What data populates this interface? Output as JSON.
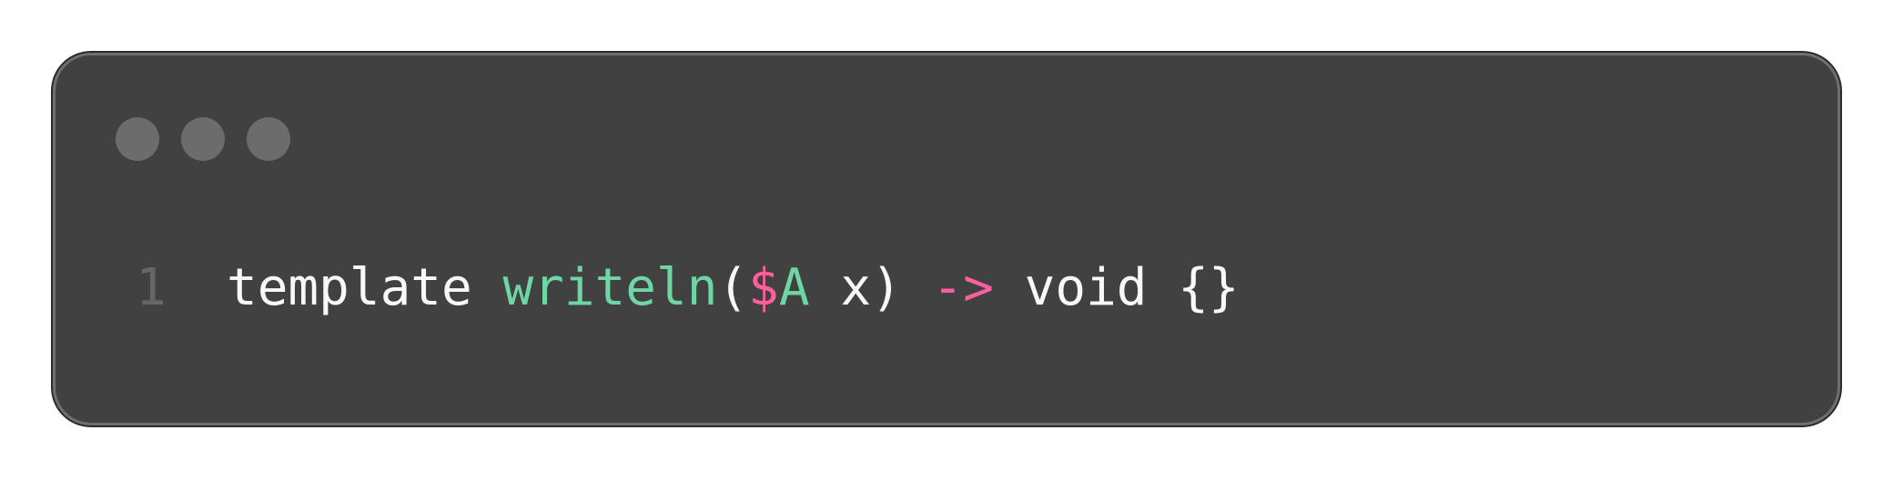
{
  "code_window": {
    "line": {
      "number": "1",
      "tokens": {
        "kw_template": "template",
        "space_1": " ",
        "fn_name": "writeln",
        "open_paren": "(",
        "dollar": "$",
        "type_param": "A",
        "space_2": " ",
        "param_name": "x",
        "close_paren": ")",
        "space_3": " ",
        "arrow": "->",
        "space_4": " ",
        "return_type": "void",
        "space_5": " ",
        "braces": "{}"
      }
    }
  },
  "colors": {
    "background": "#ffffff",
    "window": "#414141",
    "window_border": "#6f6f6f",
    "dot": "#6c6c6c",
    "line_number": "#666666",
    "default_text": "#f8f8f8",
    "function_name": "#6dd6a4",
    "type_parameter": "#6dd6a4",
    "dollar_sign": "#ff5f9d",
    "arrow": "#ff5f9d"
  }
}
